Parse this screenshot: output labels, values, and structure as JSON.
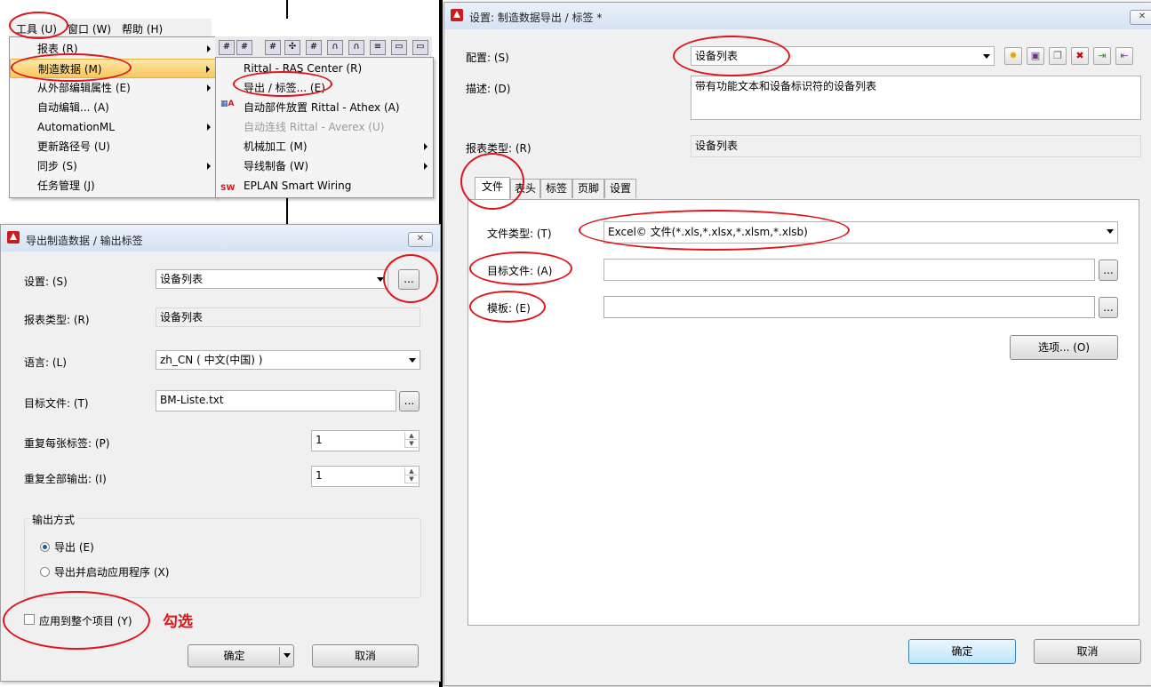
{
  "menu": {
    "bar": {
      "tools": "工具 (U)",
      "window": "窗口 (W)",
      "help": "帮助 (H)"
    },
    "items": [
      {
        "label": "报表 (R)"
      },
      {
        "label": "制造数据 (M)"
      },
      {
        "label": "从外部编辑属性 (E)"
      },
      {
        "label": "自动编辑... (A)"
      },
      {
        "label": "AutomationML"
      },
      {
        "label": "更新路径号 (U)"
      },
      {
        "label": "同步 (S)"
      },
      {
        "label": "任务管理 (J)"
      }
    ],
    "submenu": [
      {
        "label": "Rittal - RAS Center (R)"
      },
      {
        "label": "导出 / 标签... (E)"
      },
      {
        "label": "自动部件放置 Rittal - Athex (A)"
      },
      {
        "label": "自动连线 Rittal - Averex (U)"
      },
      {
        "label": "机械加工 (M)"
      },
      {
        "label": "导线制备 (W)"
      },
      {
        "label": "EPLAN Smart Wiring"
      }
    ],
    "icon_sw": "SW"
  },
  "export_dialog": {
    "title": "导出制造数据 / 输出标签",
    "settings_label": "设置: (S)",
    "settings_value": "设备列表",
    "report_type_label": "报表类型: (R)",
    "report_type_value": "设备列表",
    "language_label": "语言: (L)",
    "language_value": "zh_CN ( 中文(中国) )",
    "target_file_label": "目标文件: (T)",
    "target_file_value": "BM-Liste.txt",
    "repeat_label_label": "重复每张标签: (P)",
    "repeat_label_value": "1",
    "repeat_all_label": "重复全部输出: (I)",
    "repeat_all_value": "1",
    "output_group_title": "输出方式",
    "radio_export": "导出 (E)",
    "radio_export_launch": "导出并启动应用程序 (X)",
    "apply_project": "应用到整个项目 (Y)",
    "ok": "确定",
    "cancel": "取消",
    "ellipsis": "..."
  },
  "annotation": "勾选",
  "settings_dialog": {
    "title": "设置: 制造数据导出 / 标签 *",
    "config_label": "配置: (S)",
    "config_value": "设备列表",
    "desc_label": "描述: (D)",
    "desc_value": "带有功能文本和设备标识符的设备列表",
    "report_type_label": "报表类型: (R)",
    "report_type_value": "设备列表",
    "tabs": [
      {
        "label": "文件"
      },
      {
        "label": "表头"
      },
      {
        "label": "标签"
      },
      {
        "label": "页脚"
      },
      {
        "label": "设置"
      }
    ],
    "file_type_label": "文件类型: (T)",
    "file_type_value": "Excel© 文件(*.xls,*.xlsx,*.xlsm,*.xlsb)",
    "target_file_label": "目标文件: (A)",
    "target_file_value": "",
    "template_label": "模板: (E)",
    "template_value": "",
    "options_button": "选项... (O)",
    "ok": "确定",
    "cancel": "取消",
    "ellipsis": "..."
  },
  "colors": {
    "annotation_red": "#e0141b",
    "eplan_red": "#cc1b1b"
  }
}
